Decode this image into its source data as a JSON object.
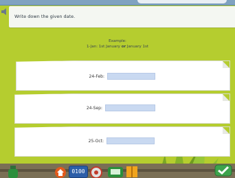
{
  "instruction": {
    "text": "Write down the given date."
  },
  "example": {
    "title": "Example:",
    "line_pre": "1-Jan: 1st January ",
    "line_bold": "or",
    "line_post": " January 1st"
  },
  "questions": [
    {
      "label": "24-Feb:",
      "value": ""
    },
    {
      "label": "24-Sep:",
      "value": ""
    },
    {
      "label": "25-Oct:",
      "value": ""
    }
  ],
  "toolbar": {
    "clock_text": "0100"
  },
  "colors": {
    "background": "#b5cd2f",
    "input": "#c9d9f1",
    "card": "#ffffff"
  }
}
